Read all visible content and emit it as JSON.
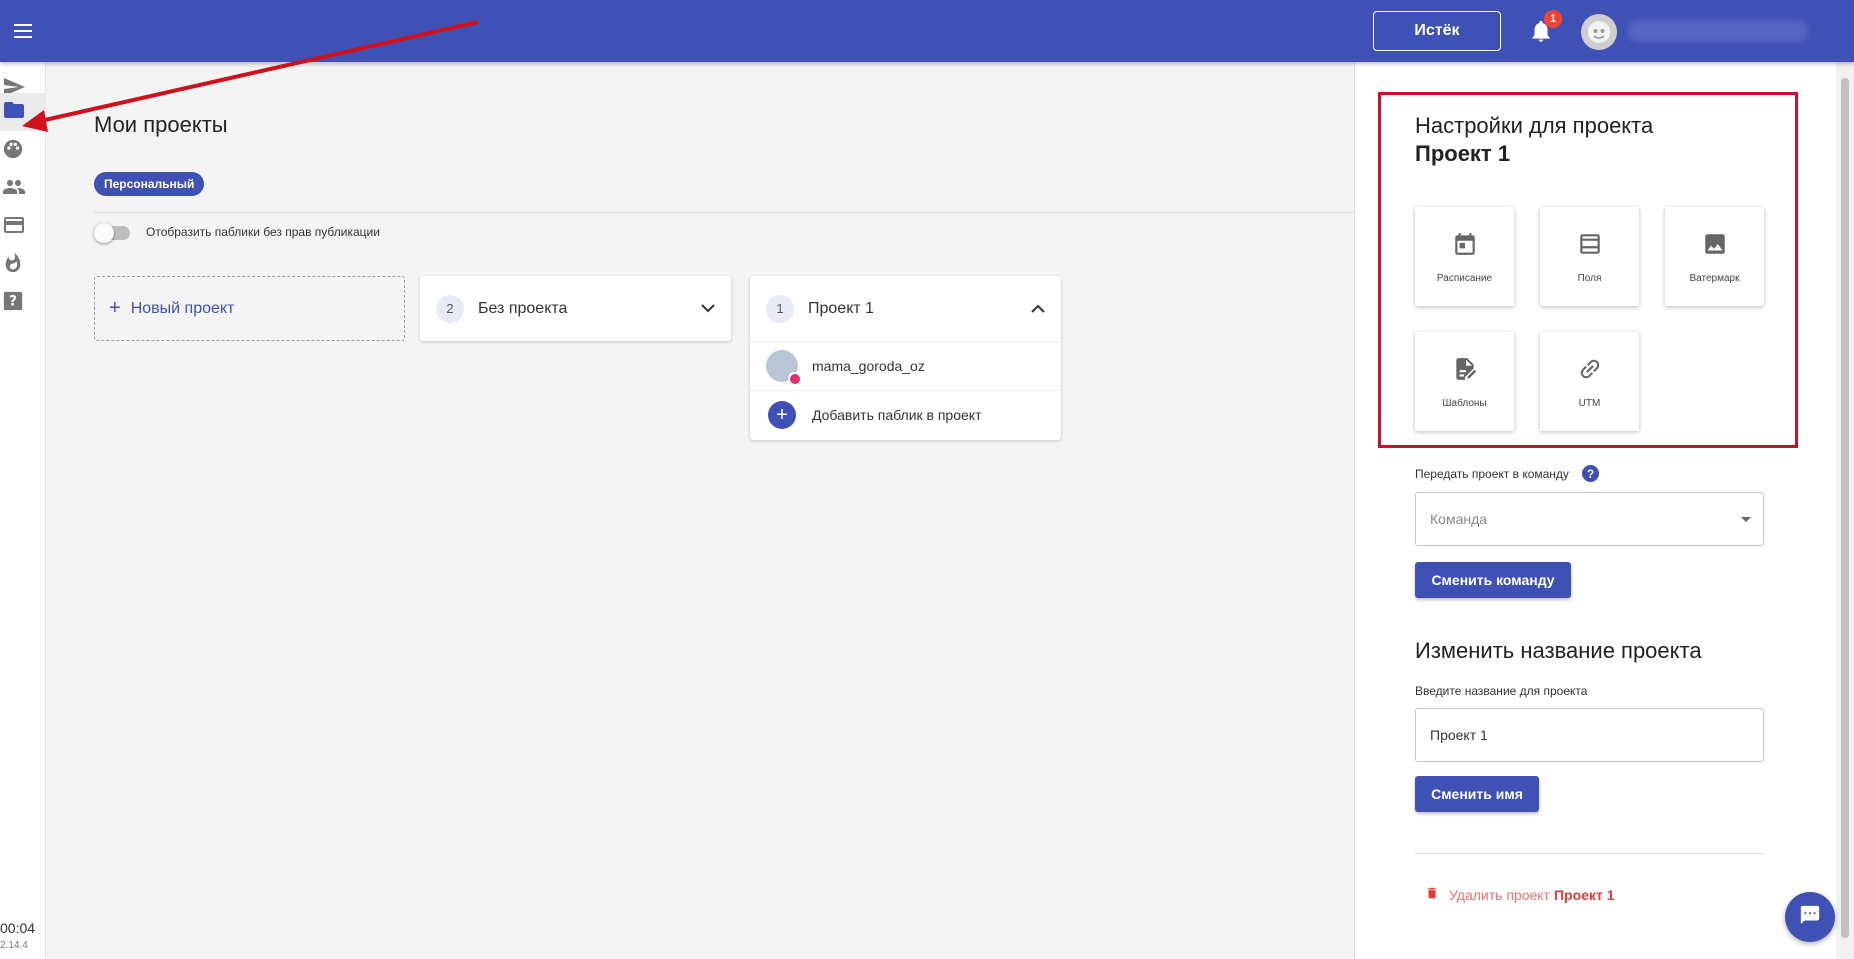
{
  "header": {
    "expired_label": "Истёк",
    "notification_count": "1"
  },
  "sidebar": {
    "items": [
      {
        "icon": "send-icon"
      },
      {
        "icon": "folder-icon"
      },
      {
        "icon": "palette-icon"
      },
      {
        "icon": "people-icon"
      },
      {
        "icon": "credit-card-icon"
      },
      {
        "icon": "fire-icon"
      },
      {
        "icon": "help-icon"
      }
    ],
    "time": "00:04",
    "version": "2.14.4"
  },
  "main": {
    "title": "Мои проекты",
    "chip": "Персональный",
    "toggle_label": "Отобразить паблики без прав публикации",
    "new_project": "Новый проект",
    "projects": [
      {
        "number": "2",
        "name": "Без проекта",
        "expanded": false
      },
      {
        "number": "1",
        "name": "Проект 1",
        "expanded": true,
        "accounts": [
          "mama_goroda_oz"
        ],
        "add_label": "Добавить паблик в проект"
      }
    ]
  },
  "panel": {
    "title_line1": "Настройки для проекта",
    "title_line2": "Проект 1",
    "tiles": [
      {
        "label": "Расписание",
        "icon": "calendar-icon"
      },
      {
        "label": "Поля",
        "icon": "fields-icon"
      },
      {
        "label": "Ватермарк",
        "icon": "image-icon"
      },
      {
        "label": "Шаблоны",
        "icon": "template-icon"
      },
      {
        "label": "UTM",
        "icon": "link-icon"
      }
    ],
    "team_label": "Передать проект в команду",
    "team_placeholder": "Команда",
    "change_team_btn": "Сменить команду",
    "rename_title": "Изменить название проекта",
    "rename_label": "Введите название для проекта",
    "rename_value": "Проект 1",
    "change_name_btn": "Сменить имя",
    "delete_label": "Удалить проект",
    "delete_project_name": "Проект 1"
  },
  "colors": {
    "primary": "#3f51b5",
    "highlight_box": "#c8102e",
    "danger": "#e53935"
  }
}
